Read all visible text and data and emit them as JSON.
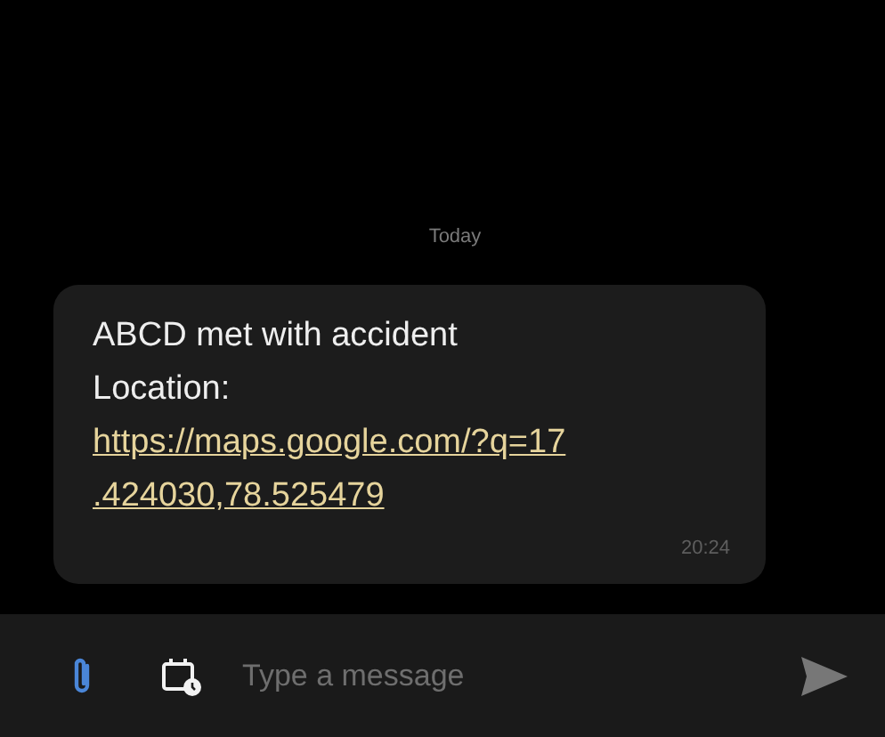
{
  "date_divider": "Today",
  "message": {
    "lines": [
      "ABCD met with accident",
      "Location:"
    ],
    "link": [
      "https://maps.google.com/?q=17",
      ".424030,78.525479"
    ],
    "time": "20:24"
  },
  "composer": {
    "placeholder": "Type a message"
  }
}
